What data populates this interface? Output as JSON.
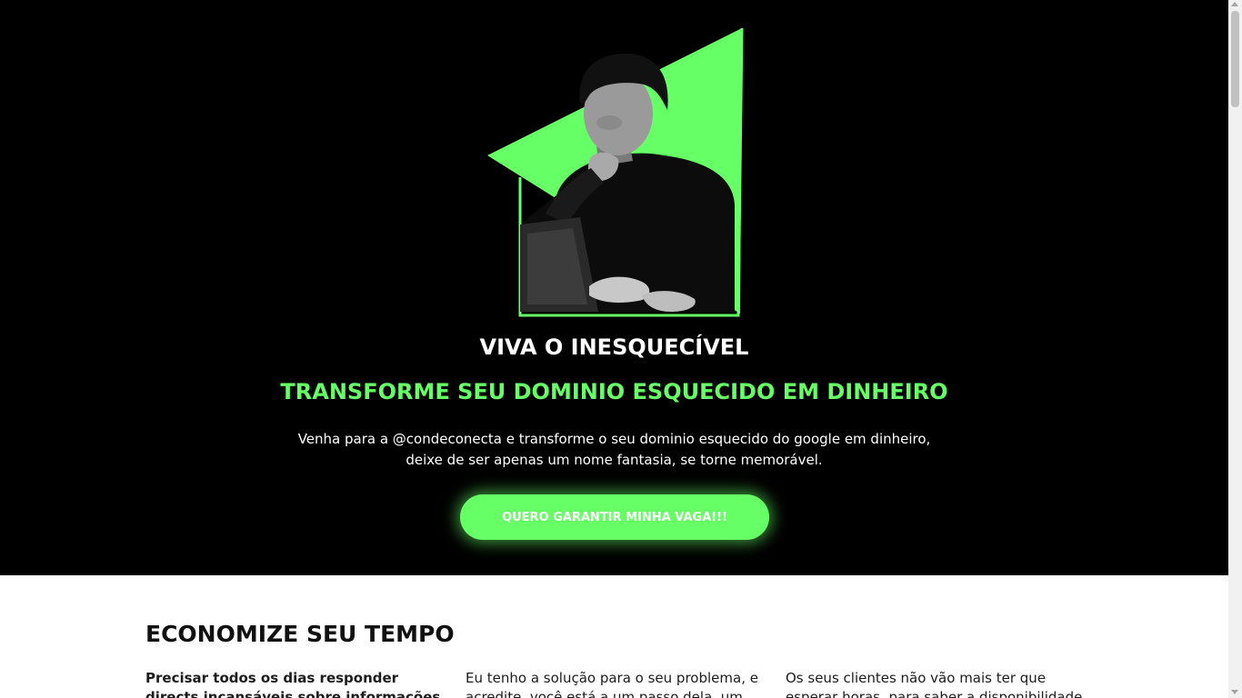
{
  "theme": {
    "accent": "#66ff66",
    "hero_bg": "#000000",
    "section_bg": "#ffffff"
  },
  "hero": {
    "image": "portrait-of-man-at-laptop-on-green-triangle",
    "title": "VIVA O INESQUECÍVEL",
    "subtitle": "TRANSFORME SEU DOMINIO ESQUECIDO EM DINHEIRO",
    "description": "Venha para a @condeconecta e transforme o seu dominio esquecido do google em dinheiro, deixe de ser apenas um nome fantasia, se torne memorável.",
    "cta_label": "QUERO GARANTIR MINHA VAGA!!!"
  },
  "benefits": {
    "title": "ECONOMIZE SEU TEMPO",
    "columns": [
      "Precisar todos os dias responder directs incansáveis sobre informações do seu",
      "Eu tenho a solução para o seu problema, e acredite, você está a um passo dela, um",
      "Os seus clientes não vão mais ter que esperar horas, para saber a disponibilidade de um"
    ]
  }
}
